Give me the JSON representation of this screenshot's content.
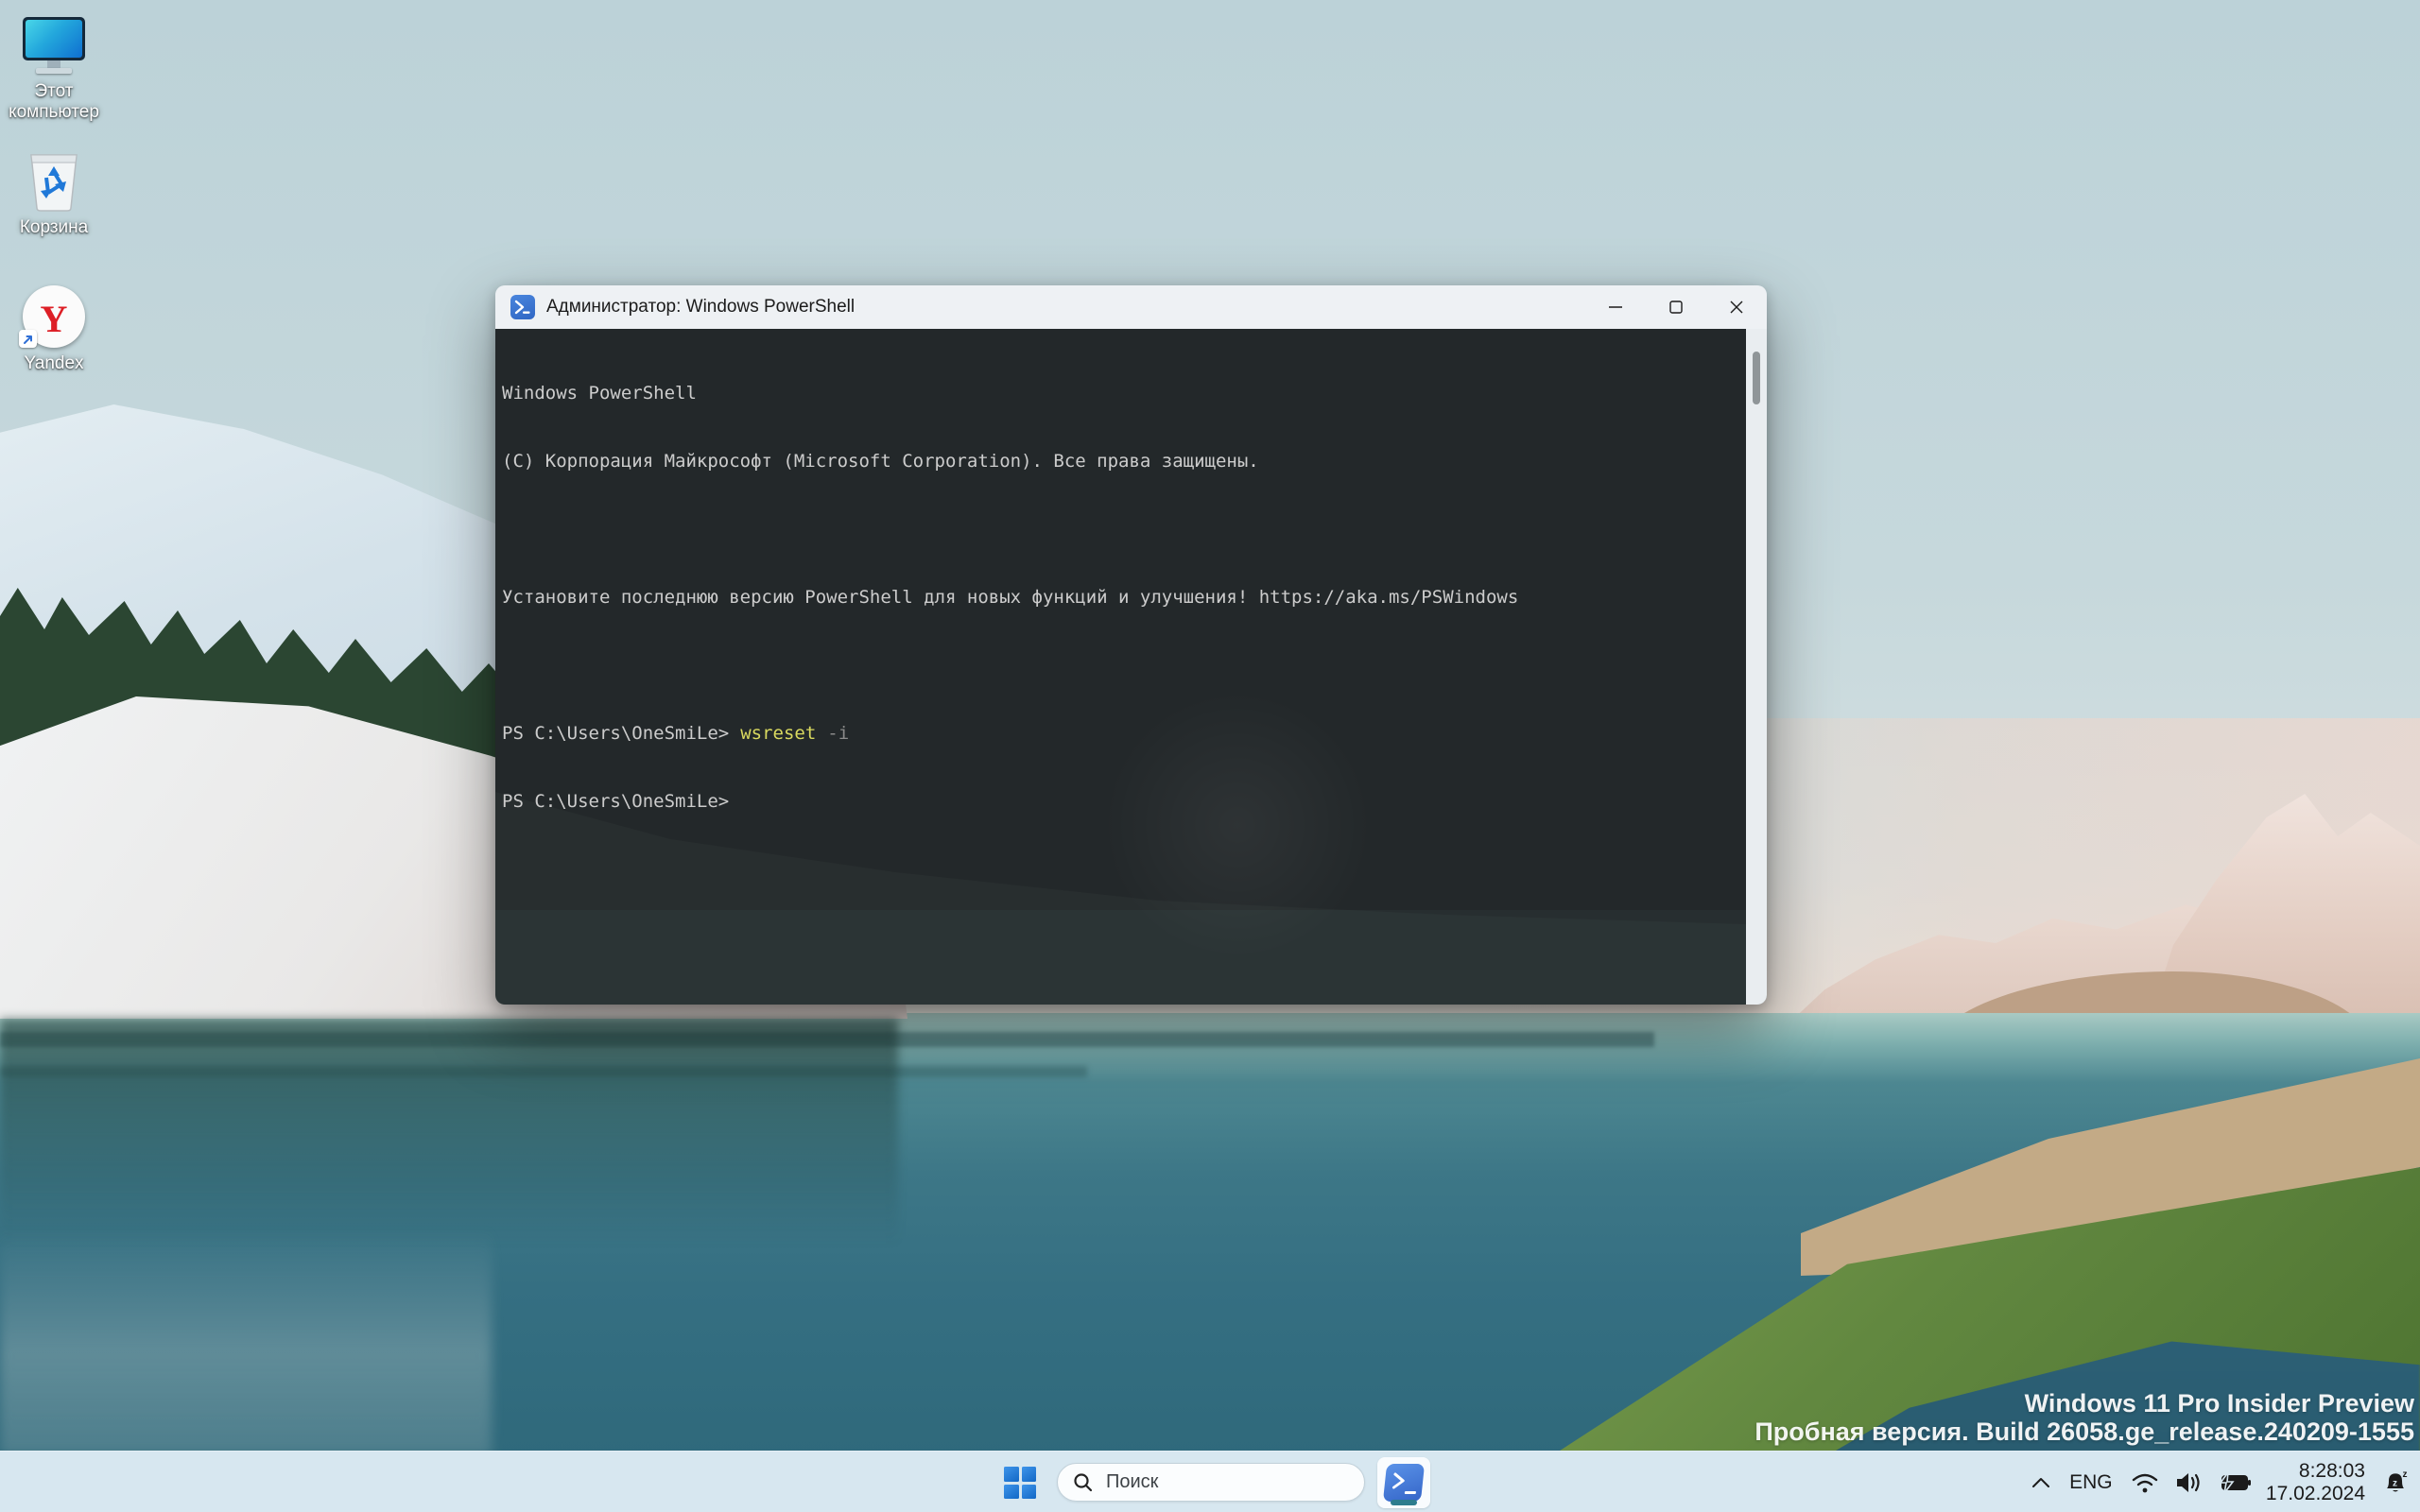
{
  "desktop": {
    "icons": [
      {
        "label": "Этот компьютер",
        "icon": "this-pc-icon"
      },
      {
        "label": "Корзина",
        "icon": "recycle-bin-icon"
      },
      {
        "label": "Yandex",
        "icon": "yandex-browser-icon"
      }
    ]
  },
  "window": {
    "title": "Администратор: Windows PowerShell",
    "console": {
      "banner_line1": "Windows PowerShell",
      "banner_line2": "(C) Корпорация Майкрософт (Microsoft Corporation). Все права защищены.",
      "update_notice": "Установите последнюю версию PowerShell для новых функций и улучшения! https://aka.ms/PSWindows",
      "prompt": "PS C:\\Users\\OneSmiLe>",
      "command": "wsreset",
      "command_arg": "-i"
    }
  },
  "taskbar": {
    "search_label": "Поиск",
    "tray": {
      "language": "ENG",
      "time": "8:28:03",
      "date": "17.02.2024"
    }
  },
  "watermark": {
    "line1": "Windows 11 Pro Insider Preview",
    "line2": "Пробная версия. Build 26058.ge_release.240209-1555"
  },
  "colors": {
    "taskbar_bg": "#d7e7f0",
    "title_bar_bg": "#eef1f4",
    "console_bg": "#23282a",
    "console_text": "#cccccc",
    "console_command_yellow": "#d9d95f",
    "console_param_gray": "#8a8a8a",
    "start_blue": "#1268c6",
    "powershell_logo_blue": "#3465c8",
    "running_indicator_teal": "#2d7d8e",
    "yandex_red": "#dd1f26",
    "lake_teal": "#3d7787"
  }
}
